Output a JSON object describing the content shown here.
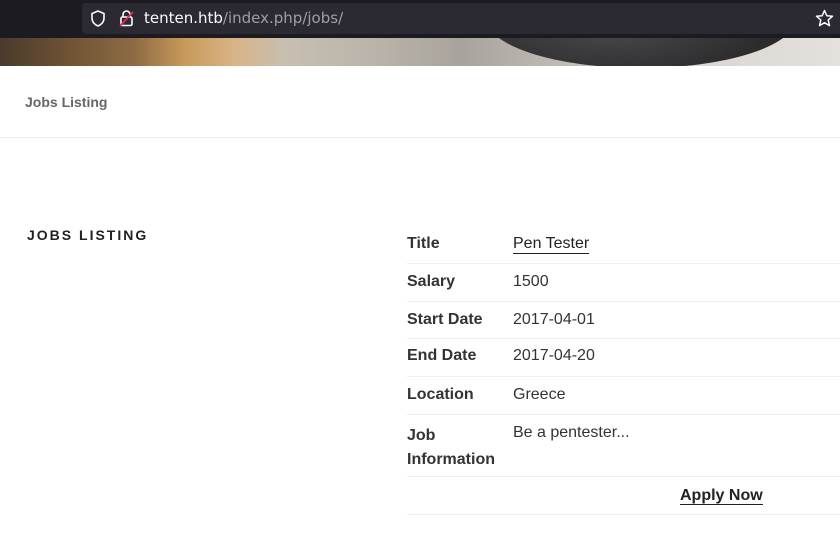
{
  "browser": {
    "url_host": "tenten.htb",
    "url_path": "/index.php/jobs/",
    "icons": [
      "shield-icon",
      "lock-icon",
      "star-icon"
    ]
  },
  "page": {
    "header_title": "Jobs Listing",
    "section_heading": "JOBS LISTING"
  },
  "job": {
    "title_label": "Title",
    "title_value": "Pen Tester",
    "salary_label": "Salary",
    "salary_value": "1500",
    "start_label": "Start Date",
    "start_value": "2017-04-01",
    "end_label": "End Date",
    "end_value": "2017-04-20",
    "location_label": "Location",
    "location_value": "Greece",
    "info_label": "Job Information",
    "info_value": "Be a pentester...",
    "apply_label": "Apply Now"
  }
}
